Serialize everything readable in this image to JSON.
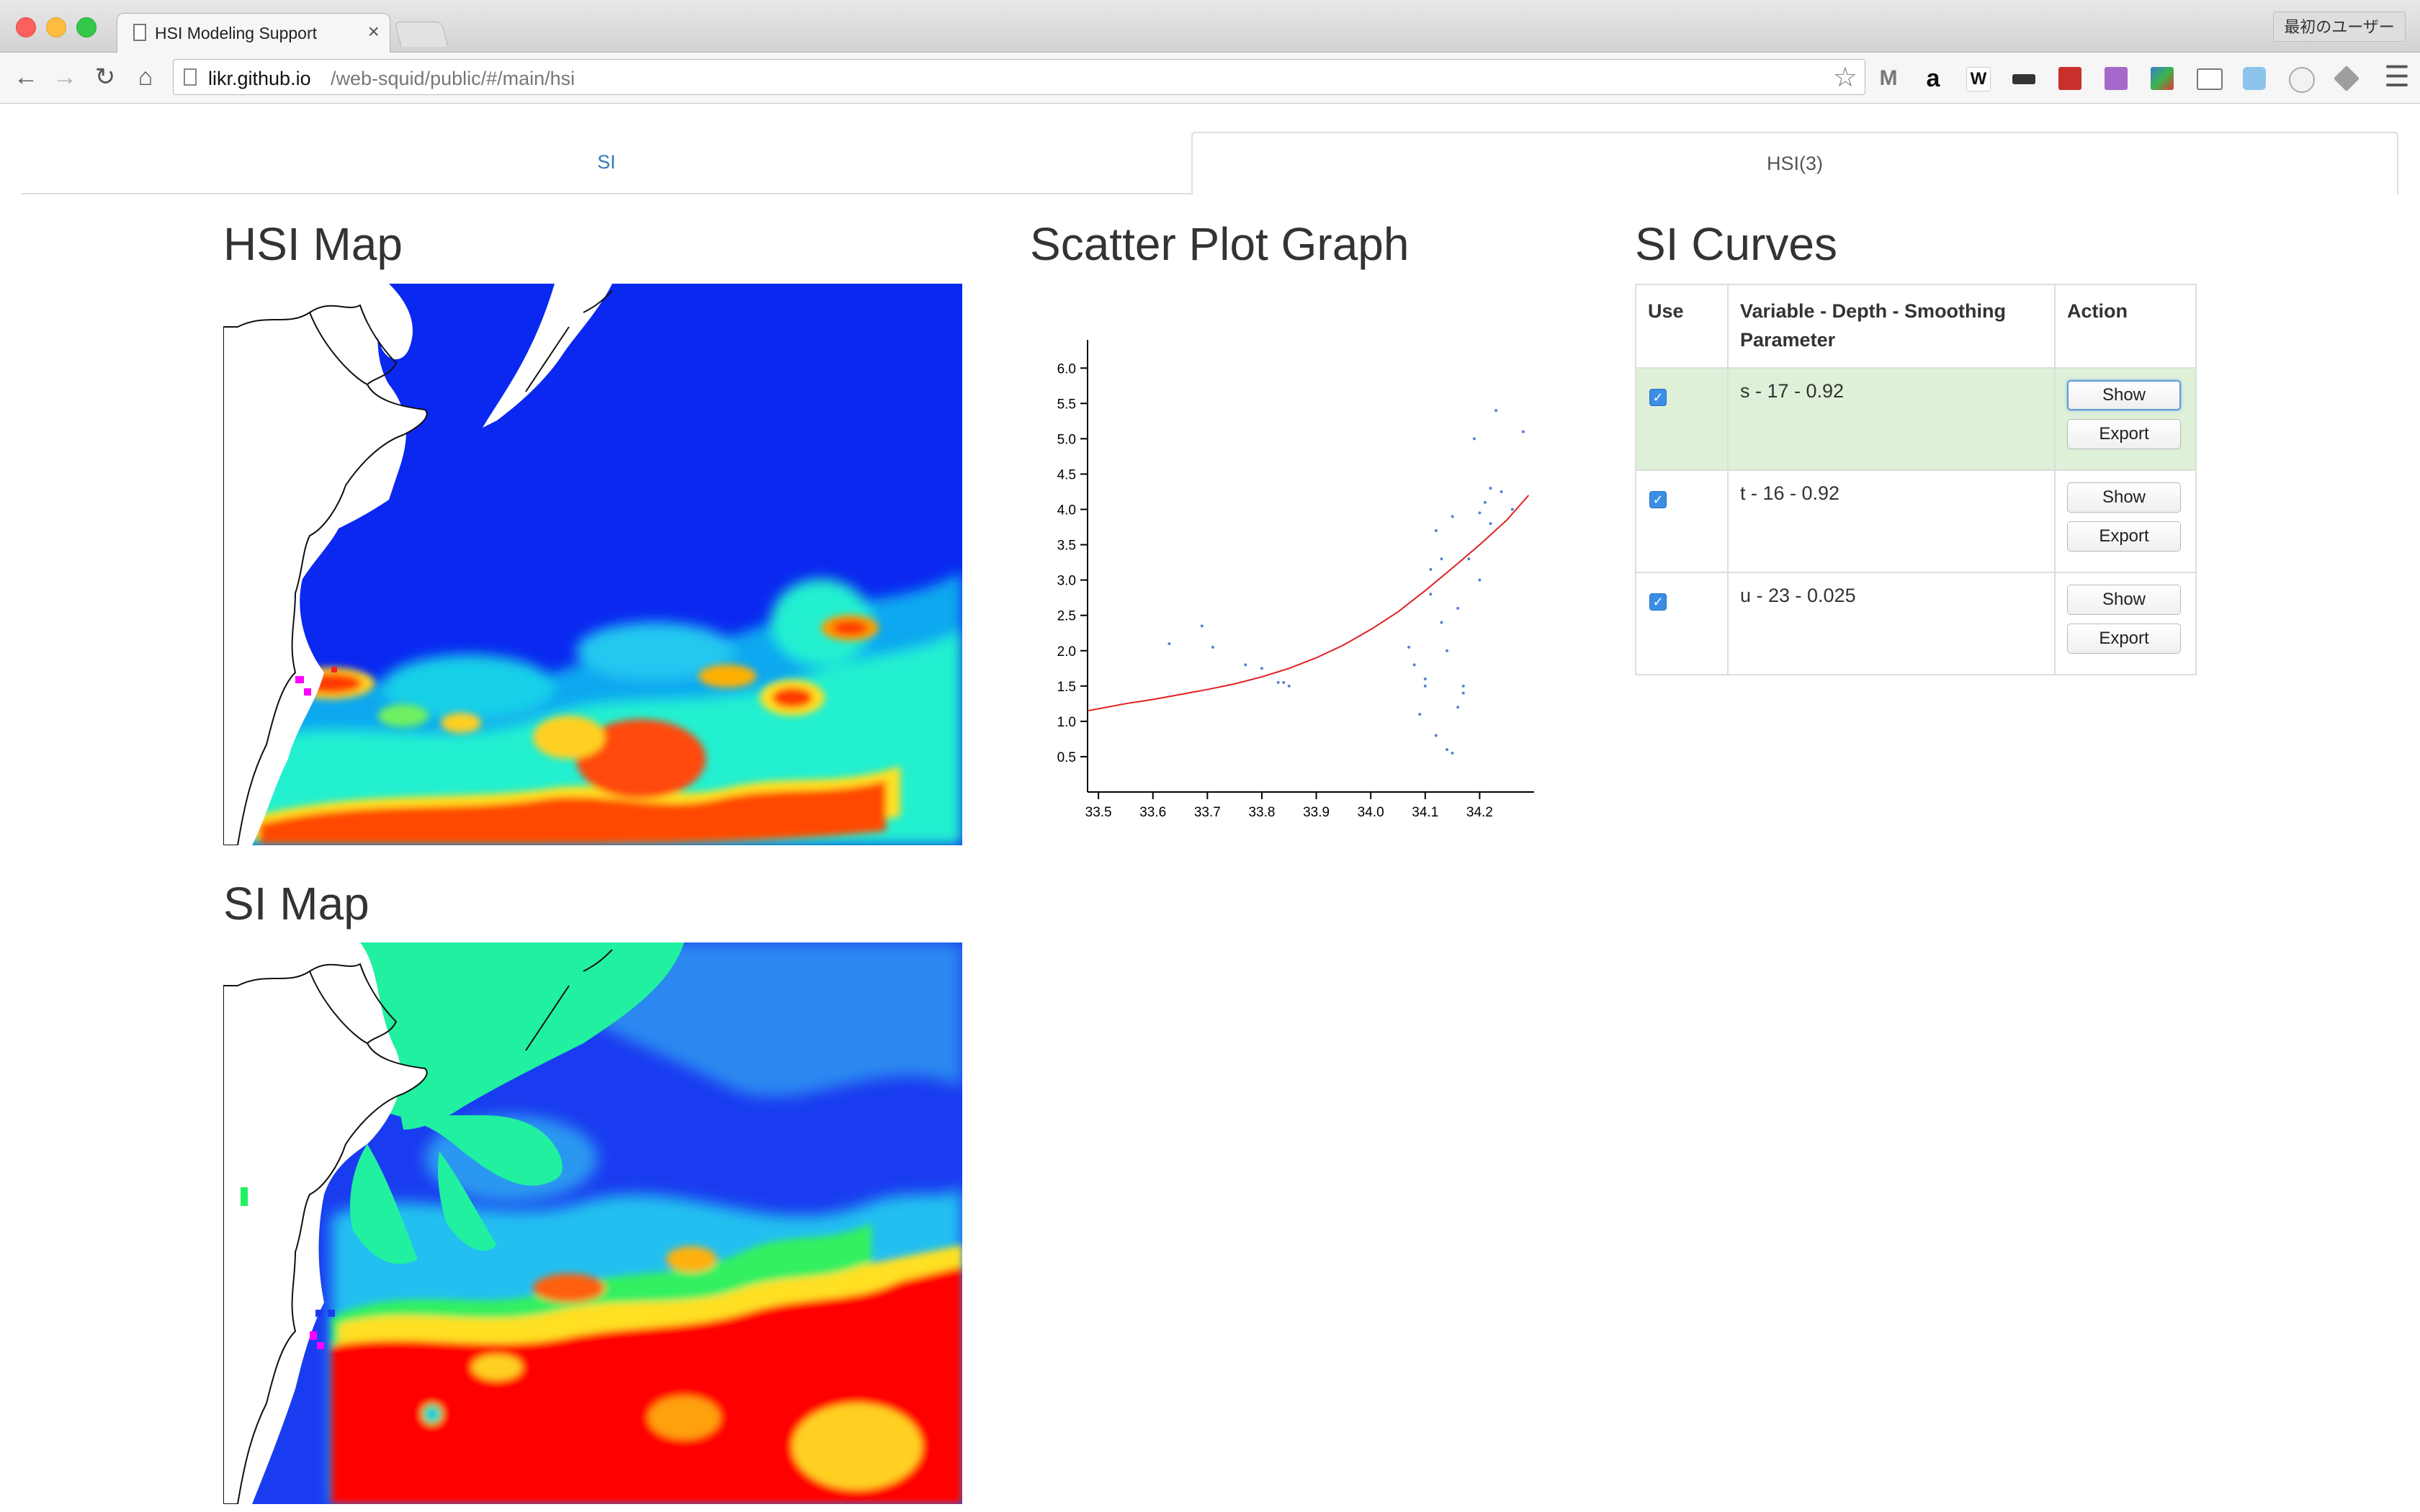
{
  "browser": {
    "tab_title": "HSI Modeling Support",
    "tab_close": "×",
    "profile_label": "最初のユーザー",
    "url_host": "likr.github.io",
    "url_path": "/web-squid/public/#/main/hsi"
  },
  "tabs": [
    {
      "label": "SI",
      "active": false
    },
    {
      "label": "HSI(3)",
      "active": true
    }
  ],
  "hsi_map": {
    "title": "HSI Map"
  },
  "si_map": {
    "title": "SI Map"
  },
  "scatter": {
    "title": "Scatter Plot Graph"
  },
  "si_curves": {
    "title": "SI Curves",
    "headers": [
      "Use",
      "Variable - Depth - Smoothing Parameter",
      "Action"
    ],
    "rows": [
      {
        "label": "s - 17 - 0.92",
        "checked": true,
        "selected": true
      },
      {
        "label": "t - 16 - 0.92",
        "checked": true,
        "selected": false
      },
      {
        "label": "u - 23 - 0.025",
        "checked": true,
        "selected": false
      }
    ],
    "show_label": "Show",
    "export_label": "Export"
  },
  "chart_data": {
    "type": "scatter",
    "title": "",
    "xlabel": "",
    "ylabel": "",
    "xlim": [
      33.48,
      34.3
    ],
    "ylim": [
      0,
      6.4
    ],
    "x_ticks": [
      33.5,
      33.6,
      33.7,
      33.8,
      33.9,
      34.0,
      34.1,
      34.2
    ],
    "y_ticks": [
      0.5,
      1.0,
      1.5,
      2.0,
      2.5,
      3.0,
      3.5,
      4.0,
      4.5,
      5.0,
      5.5,
      6.0
    ],
    "x_tick_labels": [
      "33.5",
      "33.6",
      "33.7",
      "33.8",
      "33.9",
      "34.0",
      "34.1",
      "34.2"
    ],
    "y_tick_labels": [
      "0.5",
      "1.0",
      "1.5",
      "2.0",
      "2.5",
      "3.0",
      "3.5",
      "4.0",
      "4.5",
      "5.0",
      "5.5",
      "6.0"
    ],
    "series": [
      {
        "kind": "points",
        "color": "#5b7fd6",
        "x": [
          33.63,
          33.69,
          33.71,
          33.77,
          33.8,
          33.83,
          33.84,
          33.85,
          34.07,
          34.08,
          34.09,
          34.1,
          34.1,
          34.11,
          34.11,
          34.12,
          34.12,
          34.13,
          34.13,
          34.14,
          34.14,
          34.15,
          34.15,
          34.16,
          34.16,
          34.17,
          34.17,
          34.18,
          34.19,
          34.2,
          34.2,
          34.21,
          34.22,
          34.22,
          34.23,
          34.24,
          34.26,
          34.28
        ],
        "y": [
          2.1,
          2.35,
          2.05,
          1.8,
          1.75,
          1.55,
          1.55,
          1.5,
          2.05,
          1.8,
          1.1,
          1.5,
          1.6,
          2.8,
          3.15,
          0.8,
          3.7,
          2.4,
          3.3,
          0.6,
          2.0,
          0.55,
          3.9,
          2.6,
          1.2,
          1.4,
          1.5,
          3.3,
          5.0,
          3.95,
          3.0,
          4.1,
          3.8,
          4.3,
          5.4,
          4.25,
          4.0,
          5.1
        ],
        "name": ""
      },
      {
        "kind": "curve",
        "color": "#e02020",
        "x": [
          33.48,
          33.55,
          33.6,
          33.65,
          33.7,
          33.75,
          33.8,
          33.85,
          33.9,
          33.95,
          34.0,
          34.05,
          34.1,
          34.15,
          34.2,
          34.25,
          34.29
        ],
        "y": [
          1.15,
          1.25,
          1.31,
          1.38,
          1.45,
          1.53,
          1.63,
          1.75,
          1.9,
          2.08,
          2.3,
          2.55,
          2.85,
          3.17,
          3.5,
          3.85,
          4.2
        ],
        "name": ""
      }
    ]
  }
}
